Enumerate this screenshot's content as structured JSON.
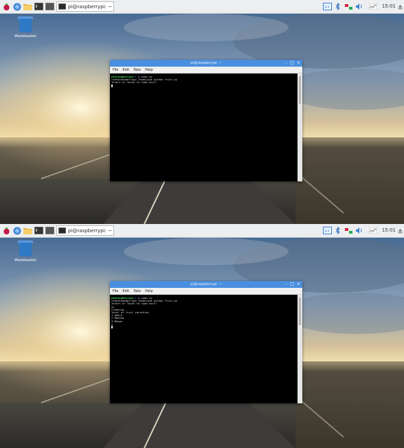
{
  "colors": {
    "taskbar_bg": "#eceef0",
    "titlebar": "#4a8fdf",
    "prompt_user": "#47e05c",
    "prompt_path": "#6ea8ff"
  },
  "taskbar": {
    "task_label": "pi@raspberrypi: ~",
    "clock": "15:01"
  },
  "desktop": {
    "trash_label": "Wastebasket"
  },
  "terminal": {
    "title": "pi@raspberrypi: ~",
    "menu": [
      "File",
      "Edit",
      "Tabs",
      "Help"
    ]
  },
  "screens": [
    {
      "lines": [
        {
          "user": "pi@raspberrypi",
          "path": ":~ $",
          "text": " sudo su"
        },
        {
          "text": "root@raspberrypi:/home/pi# python fruit.py"
        },
        {
          "text": "Insert or Touch to load exit!"
        }
      ]
    },
    {
      "lines": [
        {
          "user": "pi@raspberrypi",
          "path": ":~ $",
          "text": " sudo su"
        },
        {
          "text": "root@raspberrypi:/home/pi# python fruit.py"
        },
        {
          "text": "Insert or Touch to load exit!"
        },
        {
          "text": "s1"
        },
        {
          "text": "Cleaning..."
        },
        {
          "text": "Total of fruit varieties"
        },
        {
          "text": "1 Apple"
        },
        {
          "text": "2 Banana"
        },
        {
          "text": "3 Mango"
        },
        {
          "text": "s"
        }
      ]
    }
  ]
}
